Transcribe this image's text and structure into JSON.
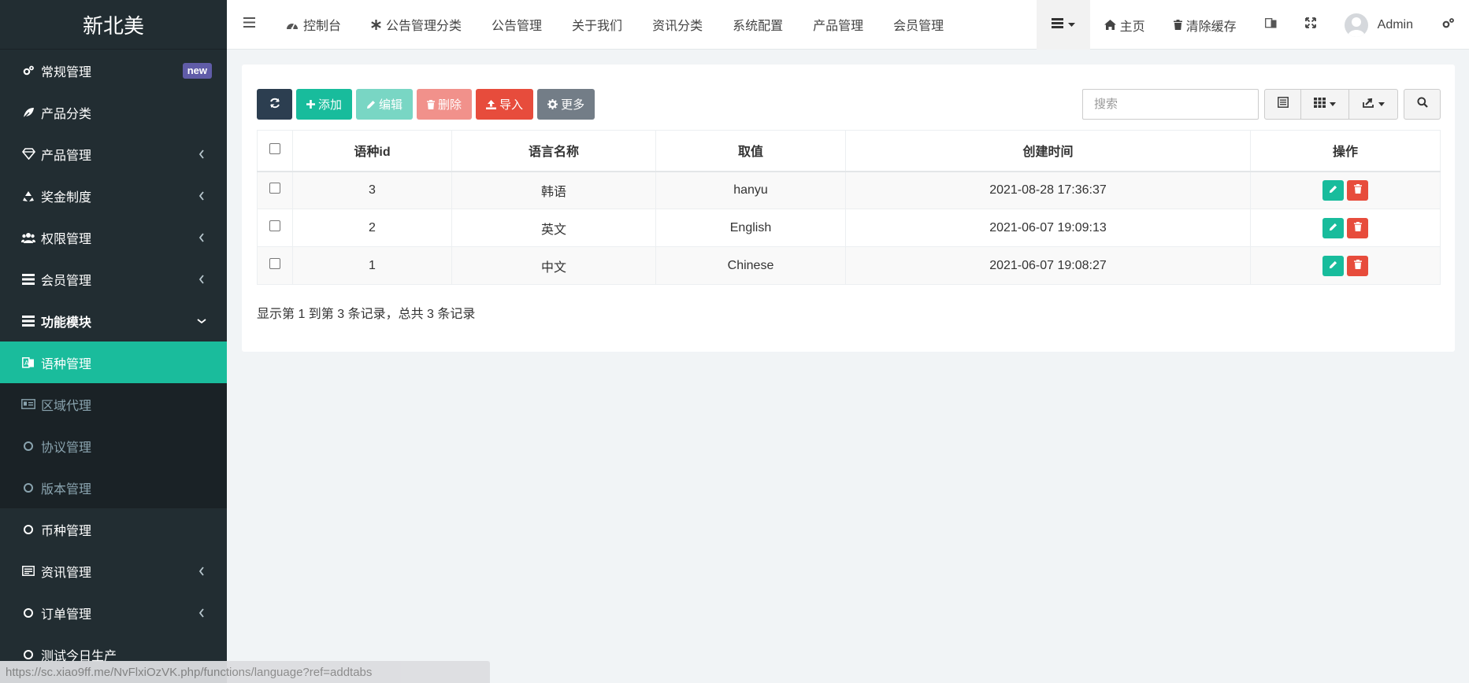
{
  "app": {
    "logo": "新北美"
  },
  "sidebar": {
    "items": [
      {
        "label": "常规管理",
        "icon": "cogs-icon",
        "badge": "new"
      },
      {
        "label": "产品分类",
        "icon": "leaf-icon"
      },
      {
        "label": "产品管理",
        "icon": "diamond-icon",
        "chevron": "left"
      },
      {
        "label": "奖金制度",
        "icon": "recycle-icon",
        "chevron": "left"
      },
      {
        "label": "权限管理",
        "icon": "group-icon",
        "chevron": "left"
      },
      {
        "label": "会员管理",
        "icon": "list-icon",
        "chevron": "left"
      },
      {
        "label": "功能模块",
        "icon": "list-icon",
        "chevron": "down",
        "bold": true
      },
      {
        "label": "语种管理",
        "icon": "language-icon",
        "active": true
      },
      {
        "label": "区域代理",
        "icon": "id-card-icon",
        "sub": true
      },
      {
        "label": "协议管理",
        "icon": "circle-icon",
        "sub": true
      },
      {
        "label": "版本管理",
        "icon": "circle-icon",
        "sub": true
      },
      {
        "label": "币种管理",
        "icon": "circle-icon"
      },
      {
        "label": "资讯管理",
        "icon": "newspaper-icon",
        "chevron": "left"
      },
      {
        "label": "订单管理",
        "icon": "circle-icon",
        "chevron": "left"
      },
      {
        "label": "测试今日生产",
        "icon": "circle-icon"
      }
    ]
  },
  "topbar": {
    "tabs": [
      {
        "label": "控制台",
        "icon": "dashboard-icon"
      },
      {
        "label": "公告管理分类",
        "icon": "asterisk-icon"
      },
      {
        "label": "公告管理"
      },
      {
        "label": "关于我们"
      },
      {
        "label": "资讯分类"
      },
      {
        "label": "系统配置"
      },
      {
        "label": "产品管理"
      },
      {
        "label": "会员管理"
      }
    ],
    "home_label": "主页",
    "clear_cache_label": "清除缓存",
    "user_name": "Admin"
  },
  "toolbar": {
    "add_label": "添加",
    "edit_label": "编辑",
    "delete_label": "删除",
    "import_label": "导入",
    "more_label": "更多"
  },
  "search": {
    "placeholder": "搜索"
  },
  "table": {
    "columns": [
      "语种id",
      "语言名称",
      "取值",
      "创建时间",
      "操作"
    ],
    "rows": [
      {
        "id": "3",
        "name": "韩语",
        "value": "hanyu",
        "created": "2021-08-28 17:36:37"
      },
      {
        "id": "2",
        "name": "英文",
        "value": "English",
        "created": "2021-06-07 19:09:13"
      },
      {
        "id": "1",
        "name": "中文",
        "value": "Chinese",
        "created": "2021-06-07 19:08:27"
      }
    ]
  },
  "pager": {
    "info": "显示第 1 到第 3 条记录，总共 3 条记录"
  },
  "status_url": "https://sc.xiao9ff.me/NvFlxiOzVK.php/functions/language?ref=addtabs",
  "colors": {
    "sidebar_bg": "#222d32",
    "active": "#1abc9c",
    "danger": "#e74c3c",
    "primary_dark": "#2c3e50"
  }
}
